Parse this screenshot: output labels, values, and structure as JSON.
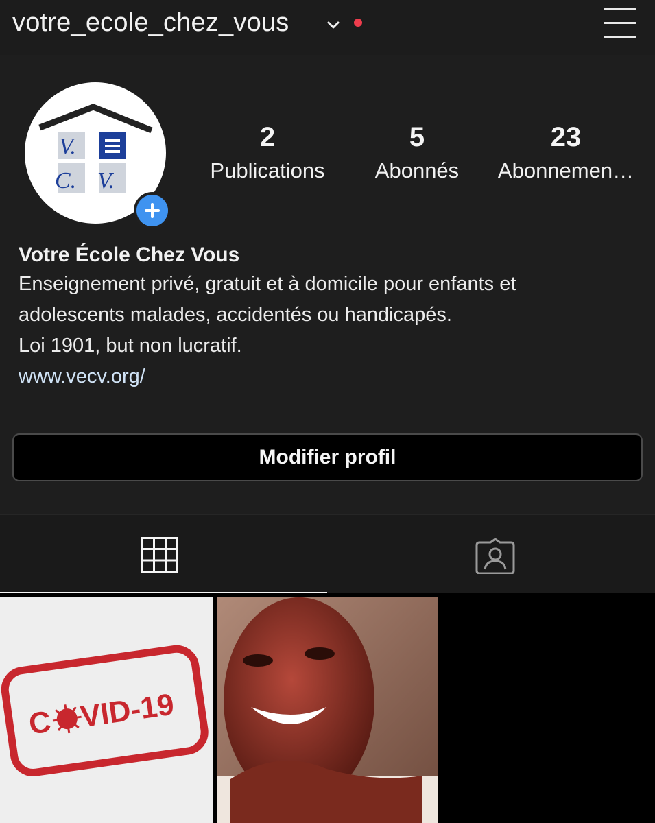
{
  "header": {
    "username": "votre_ecole_chez_vous",
    "icons": {
      "dropdown": "chevron-down-icon",
      "notification": "notification-dot",
      "menu": "hamburger-menu-icon"
    },
    "colors": {
      "notification_dot": "#ef3d4d"
    }
  },
  "avatar": {
    "logo_letters": [
      "V.",
      "C.",
      "V."
    ],
    "add_icon": "plus-icon",
    "add_color": "#3f93f0"
  },
  "stats": [
    {
      "value": "2",
      "label": "Publications"
    },
    {
      "value": "5",
      "label": "Abonnés"
    },
    {
      "value": "23",
      "label": "Abonnemen…"
    }
  ],
  "bio": {
    "name": "Votre École Chez Vous",
    "lines": [
      "Enseignement privé, gratuit et à domicile pour enfants et",
      "adolescents malades, accidentés ou handicapés.",
      "Loi 1901, but non lucratif."
    ],
    "link": "www.vecv.org/"
  },
  "edit_button": {
    "label": "Modifier profil"
  },
  "tabs": [
    {
      "icon": "grid-icon",
      "active": true
    },
    {
      "icon": "tagged-person-icon",
      "active": false
    }
  ],
  "posts": [
    {
      "stamp_text": "C",
      "stamp_text2": "VID-19"
    },
    {
      "kind": "photo"
    }
  ]
}
